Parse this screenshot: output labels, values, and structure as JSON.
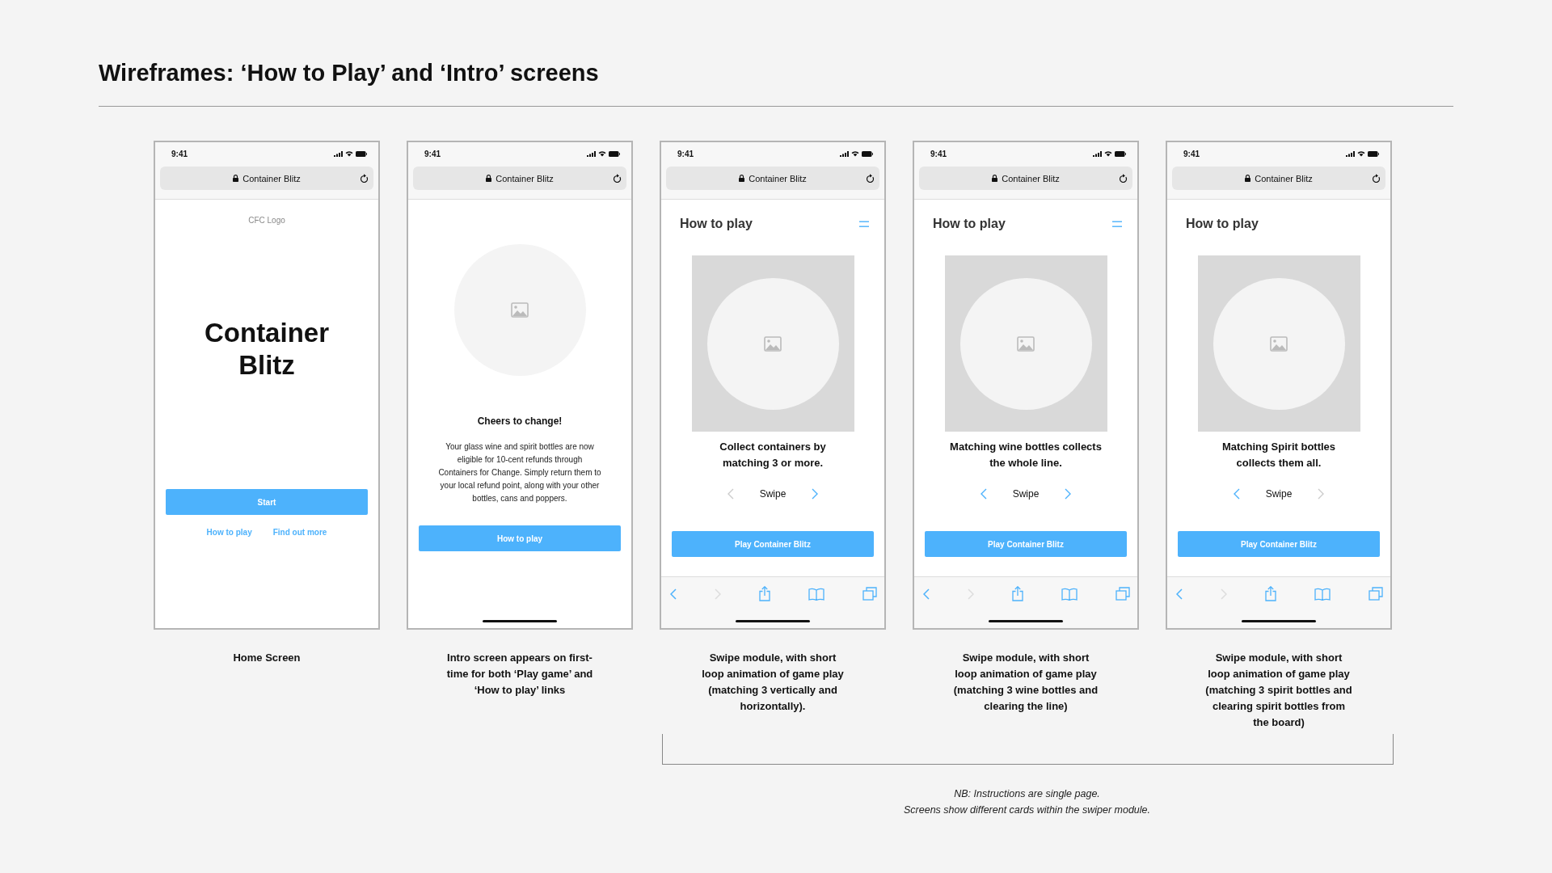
{
  "title": "Wireframes: ‘How to Play’ and ‘Intro’ screens",
  "screens": [
    {
      "kind": "home",
      "status_time": "9:41",
      "address": "Container Blitz",
      "logo_label": "CFC Logo",
      "app_title": "Container Blitz",
      "primary_button": "Start",
      "links": [
        "How to play",
        "Find out more"
      ],
      "home_indicator": false,
      "caption": "Home Screen"
    },
    {
      "kind": "intro",
      "status_time": "9:41",
      "address": "Container Blitz",
      "heading": "Cheers to change!",
      "body": "Your glass wine and spirit bottles are now eligible for 10-cent refunds through Containers for Change. Simply return them to your local refund point, along with your other bottles, cans and poppers.",
      "primary_button": "How to play",
      "home_indicator": true,
      "caption": "Intro screen appears on first-time for both ‘Play game’ and ‘How to play’ links"
    },
    {
      "kind": "how_to",
      "status_time": "9:41",
      "address": "Container Blitz",
      "heading": "How to play",
      "menu_icon": true,
      "card_text": "Collect containers by matching 3 or more.",
      "swipe_label": "Swipe",
      "prev_enabled": false,
      "next_enabled": true,
      "primary_button": "Play Container Blitz",
      "home_indicator": true,
      "caption": "Swipe module, with short loop animation of game play (matching 3 vertically and horizontally)."
    },
    {
      "kind": "how_to",
      "status_time": "9:41",
      "address": "Container Blitz",
      "heading": "How to play",
      "menu_icon": true,
      "card_text": "Matching wine bottles collects the whole line.",
      "swipe_label": "Swipe",
      "prev_enabled": true,
      "next_enabled": true,
      "primary_button": "Play Container Blitz",
      "home_indicator": true,
      "caption": "Swipe module, with short loop animation of game play (matching 3 wine bottles and clearing the line)"
    },
    {
      "kind": "how_to",
      "status_time": "9:41",
      "address": "Container Blitz",
      "heading": "How to play",
      "menu_icon": false,
      "card_text": "Matching Spirit bottles collects them all.",
      "swipe_label": "Swipe",
      "prev_enabled": true,
      "next_enabled": false,
      "primary_button": "Play Container Blitz",
      "home_indicator": true,
      "caption": "Swipe module, with short loop animation of game play (matching 3 spirit bottles and clearing spirit bottles from the board)"
    }
  ],
  "notes": [
    "NB: Instructions are single page.",
    "Screens show different cards within the swiper module."
  ]
}
